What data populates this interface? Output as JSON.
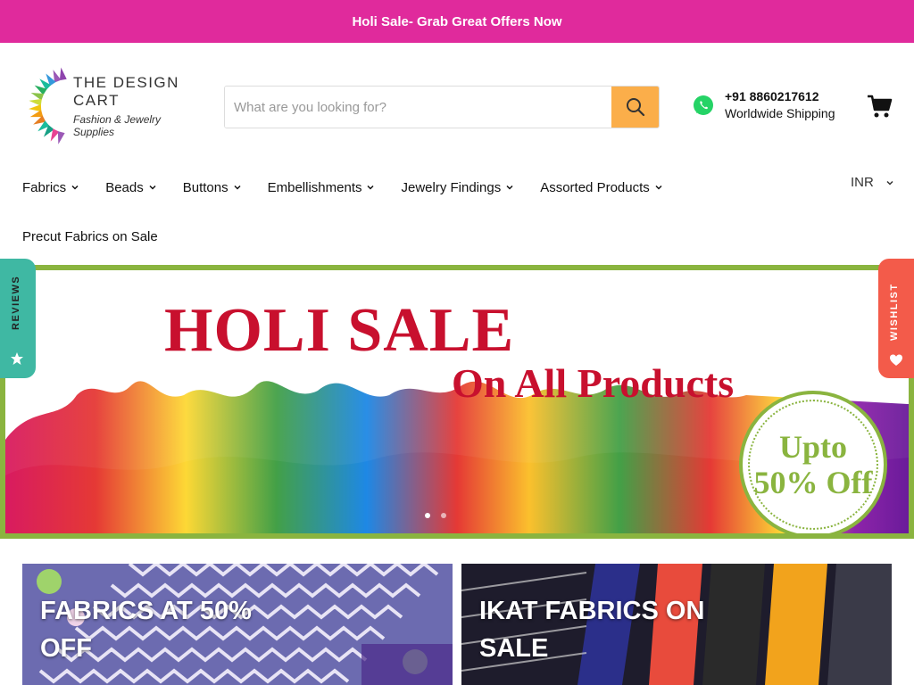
{
  "announcement": {
    "text": "Holi Sale- Grab Great Offers Now"
  },
  "header": {
    "logo": {
      "name_part1": "THE",
      "name_part2": "DESIGN",
      "name_part3": "CART",
      "tagline": "Fashion & Jewelry Supplies"
    },
    "search": {
      "placeholder": "What are you looking for?"
    },
    "contact": {
      "phone": "+91 8860217612",
      "shipping": "Worldwide Shipping"
    }
  },
  "nav": {
    "items": [
      {
        "label": "Fabrics"
      },
      {
        "label": "Beads"
      },
      {
        "label": "Buttons"
      },
      {
        "label": "Embellishments"
      },
      {
        "label": "Jewelry Findings"
      },
      {
        "label": "Assorted Products"
      }
    ],
    "row2_item": "Precut Fabrics on Sale",
    "currency": "INR"
  },
  "side_tabs": {
    "reviews": "REVIEWS",
    "wishlist": "WISHLIST"
  },
  "hero": {
    "title": "HOLI SALE",
    "subtitle": "On All Products",
    "badge_line1": "Upto",
    "badge_line2": "50% Off",
    "slides_total": 2,
    "active_slide": 1
  },
  "tiles": [
    {
      "title": "FABRICS AT 50% OFF"
    },
    {
      "title": "IKAT FABRICS ON SALE"
    }
  ],
  "colors": {
    "announcement_bg": "#e02a9c",
    "search_button": "#fbae4a",
    "hero_border": "#8ab43f",
    "hero_red": "#c8102e",
    "reviews_tab": "#3fb8a3",
    "wishlist_tab": "#f35b4a"
  }
}
